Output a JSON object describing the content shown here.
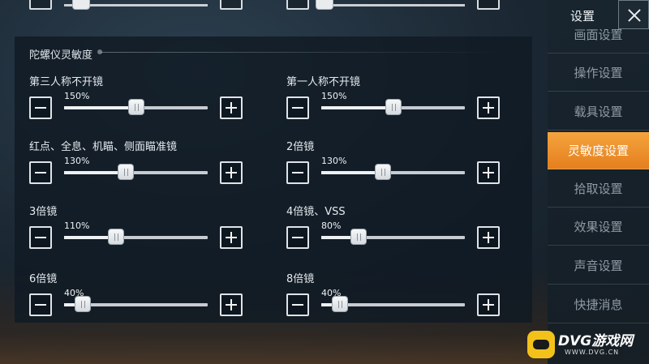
{
  "section": {
    "title": "陀螺仪灵敏度"
  },
  "sliders": [
    {
      "label": "第三人称不开镜",
      "value": "150%",
      "fraction": 0.5
    },
    {
      "label": "第一人称不开镜",
      "value": "150%",
      "fraction": 0.5
    },
    {
      "label": "红点、全息、机瞄、侧面瞄准镜",
      "value": "130%",
      "fraction": 0.43
    },
    {
      "label": "2倍镜",
      "value": "130%",
      "fraction": 0.43
    },
    {
      "label": "3倍镜",
      "value": "110%",
      "fraction": 0.36
    },
    {
      "label": "4倍镜、VSS",
      "value": "80%",
      "fraction": 0.26
    },
    {
      "label": "6倍镜",
      "value": "40%",
      "fraction": 0.13
    },
    {
      "label": "8倍镜",
      "value": "40%",
      "fraction": 0.13
    }
  ],
  "top_partial": [
    {
      "fraction": 0.08
    },
    {
      "fraction": 0.08
    }
  ],
  "sidebar": {
    "title": "设置",
    "items": [
      {
        "label": "画面设置",
        "active": false
      },
      {
        "label": "操作设置",
        "active": false
      },
      {
        "label": "载具设置",
        "active": false
      },
      {
        "label": "灵敏度设置",
        "active": true
      },
      {
        "label": "拾取设置",
        "active": false
      },
      {
        "label": "效果设置",
        "active": false
      },
      {
        "label": "声音设置",
        "active": false
      },
      {
        "label": "快捷消息",
        "active": false
      }
    ]
  },
  "watermark": {
    "main": "DVG游戏网",
    "sub": "WWW.DVG.CN"
  },
  "colors": {
    "accent": "#ec8f2a",
    "panel": "#101a23"
  }
}
